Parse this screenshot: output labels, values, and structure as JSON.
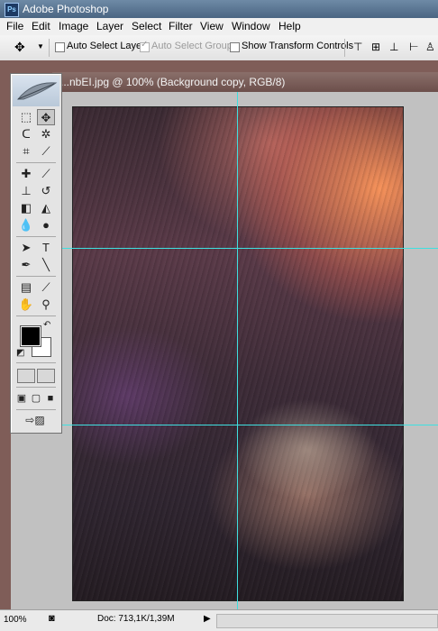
{
  "app": {
    "title": "Adobe Photoshop",
    "icon_text": "Ps"
  },
  "menu": [
    "File",
    "Edit",
    "Image",
    "Layer",
    "Select",
    "Filter",
    "View",
    "Window",
    "Help"
  ],
  "options": {
    "auto_select_layer": "Auto Select Layer",
    "auto_select_groups": "Auto Select Groups",
    "show_transform_controls": "Show Transform Controls",
    "auto_select_groups_checked": true
  },
  "document": {
    "title": "...nbEI.jpg @ 100% (Background copy, RGB/8)"
  },
  "status": {
    "zoom": "100%",
    "doc_size": "Doc: 713,1K/1,39M"
  },
  "colors": {
    "guide": "#3fe0e0",
    "foreground": "#000000",
    "background": "#ffffff"
  }
}
